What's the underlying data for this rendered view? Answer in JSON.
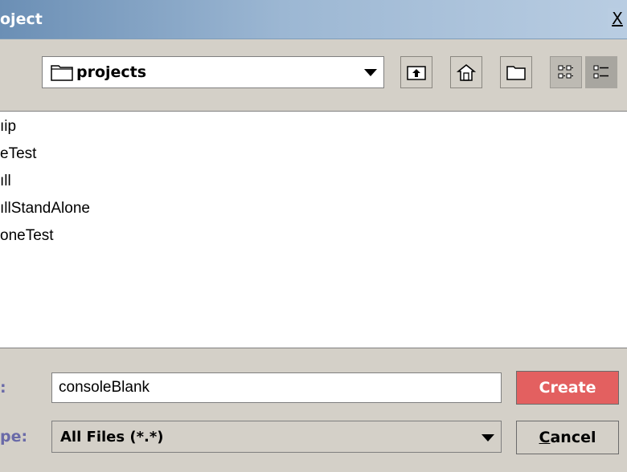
{
  "window": {
    "title": "oject",
    "close_label": "X"
  },
  "lookin": {
    "value": "projects"
  },
  "toolbar": {
    "buttons": [
      {
        "name": "up-folder-button",
        "icon": "up-folder-icon"
      },
      {
        "name": "home-button",
        "icon": "home-icon"
      },
      {
        "name": "new-folder-button",
        "icon": "new-folder-icon"
      },
      {
        "name": "list-view-button",
        "icon": "list-view-icon"
      },
      {
        "name": "details-view-button",
        "icon": "details-view-icon",
        "selected": true
      }
    ]
  },
  "files": [
    "ıip",
    "eTest",
    "ıll",
    "ıllStandAlone",
    "oneTest"
  ],
  "filename": {
    "label": ":",
    "value": "consoleBlank"
  },
  "filetype": {
    "label": "pe:",
    "value": "All Files (*.*)"
  },
  "actions": {
    "create_label": "Create",
    "cancel_mnemonic": "C",
    "cancel_rest": "ancel"
  },
  "colors": {
    "accent_create": "#e36060",
    "title_gradient_start": "#6b8fb5"
  }
}
